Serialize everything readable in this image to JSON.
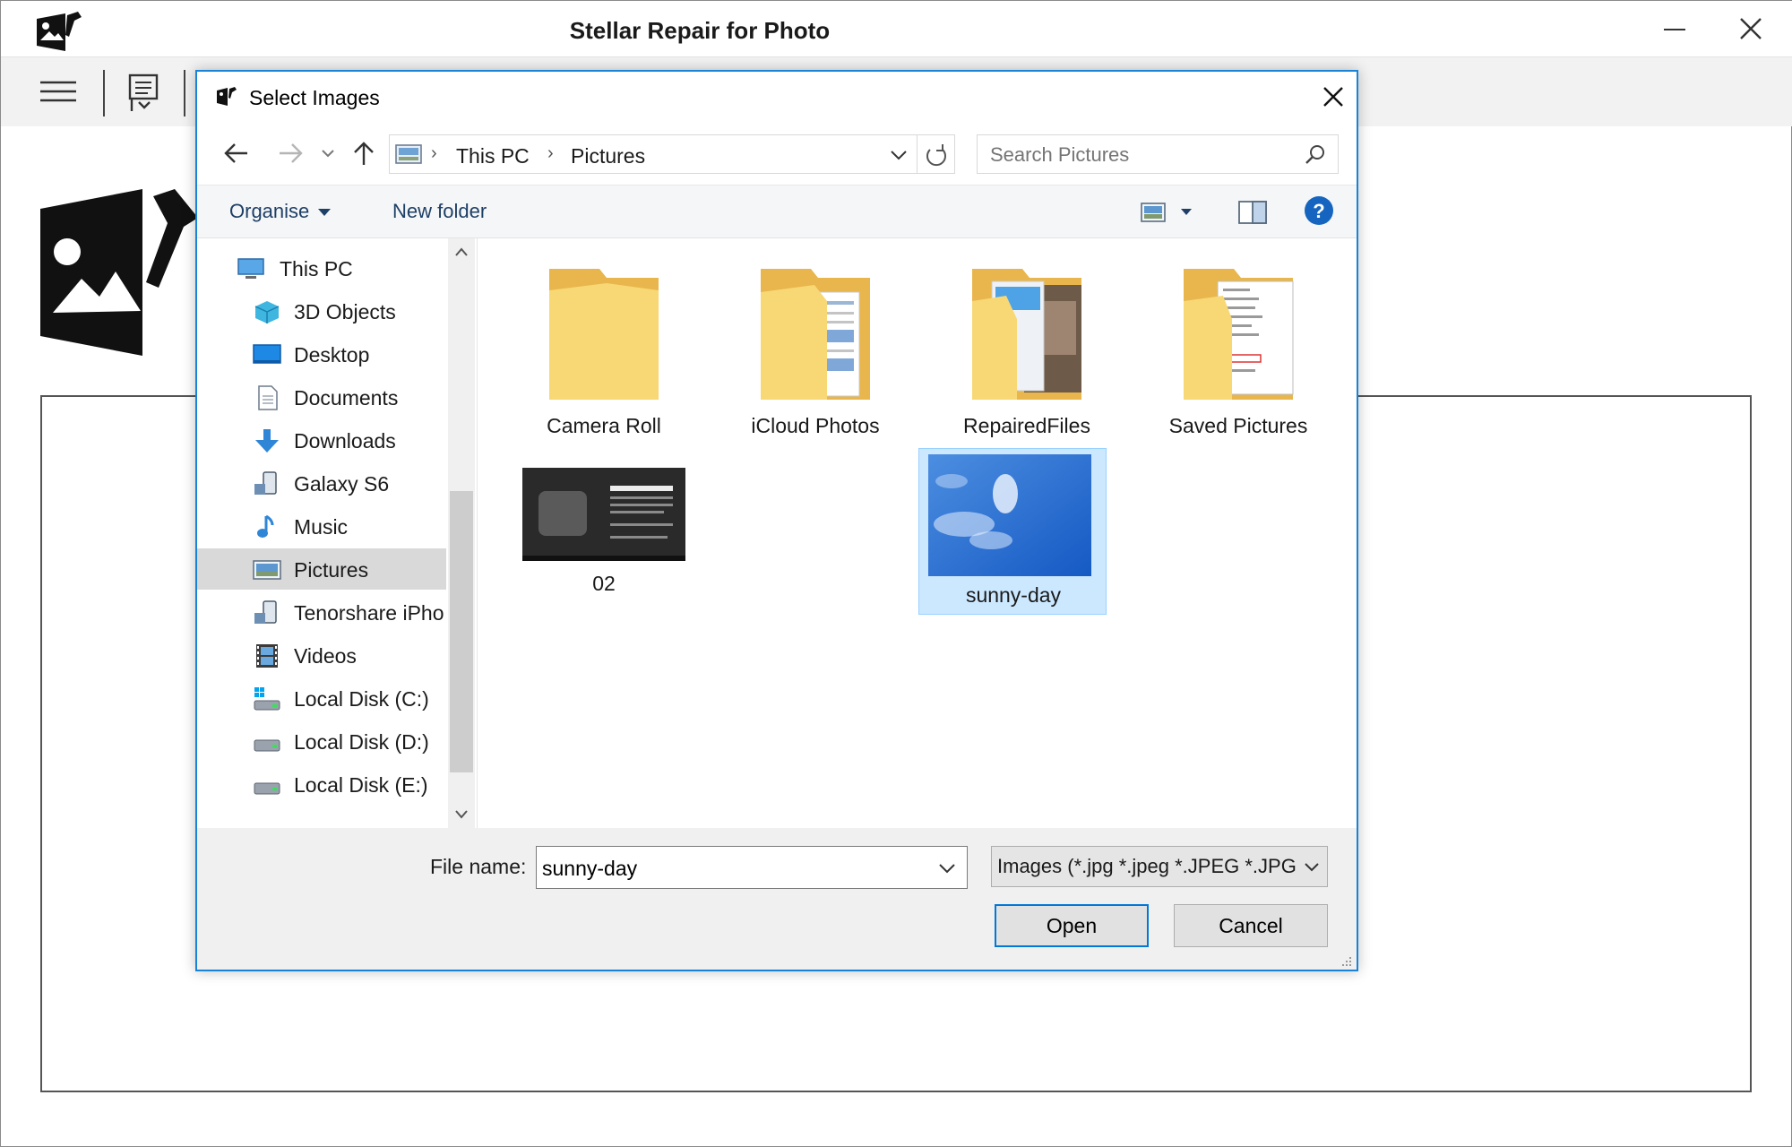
{
  "app": {
    "title": "Stellar Repair for Photo"
  },
  "dialog": {
    "title": "Select Images",
    "breadcrumb": [
      "This PC",
      "Pictures"
    ],
    "search_placeholder": "Search Pictures",
    "commands": {
      "organise": "Organise",
      "new_folder": "New folder"
    },
    "nav_items": [
      {
        "label": "This PC",
        "icon": "computer-icon"
      },
      {
        "label": "3D Objects",
        "icon": "cube-icon"
      },
      {
        "label": "Desktop",
        "icon": "desktop-icon"
      },
      {
        "label": "Documents",
        "icon": "document-icon"
      },
      {
        "label": "Downloads",
        "icon": "download-arrow-icon"
      },
      {
        "label": "Galaxy S6",
        "icon": "phone-icon"
      },
      {
        "label": "Music",
        "icon": "music-note-icon"
      },
      {
        "label": "Pictures",
        "icon": "pictures-icon",
        "selected": true
      },
      {
        "label": "Tenorshare iPho",
        "icon": "phone-icon"
      },
      {
        "label": "Videos",
        "icon": "film-icon"
      },
      {
        "label": "Local Disk (C:)",
        "icon": "drive-icon"
      },
      {
        "label": "Local Disk (D:)",
        "icon": "drive-icon"
      },
      {
        "label": "Local Disk (E:)",
        "icon": "drive-icon"
      }
    ],
    "tiles": [
      {
        "label": "Camera Roll",
        "kind": "folder-empty"
      },
      {
        "label": "iCloud Photos",
        "kind": "folder-docs"
      },
      {
        "label": "RepairedFiles",
        "kind": "folder-photos"
      },
      {
        "label": "Saved Pictures",
        "kind": "folder-sheets"
      },
      {
        "label": "02",
        "kind": "image-dark"
      },
      {
        "label": "sunny-day",
        "kind": "image-sky",
        "selected": true
      }
    ],
    "file_name_label": "File name:",
    "file_name_value": "sunny-day",
    "file_type": "Images (*.jpg *.jpeg *.JPEG *.JPG",
    "open_label": "Open",
    "cancel_label": "Cancel"
  },
  "colors": {
    "accent": "#0078d7",
    "dialog_border": "#1883d7",
    "selection": "#cce8ff",
    "folder": "#f8d775",
    "sky": "#1f6fd6"
  }
}
